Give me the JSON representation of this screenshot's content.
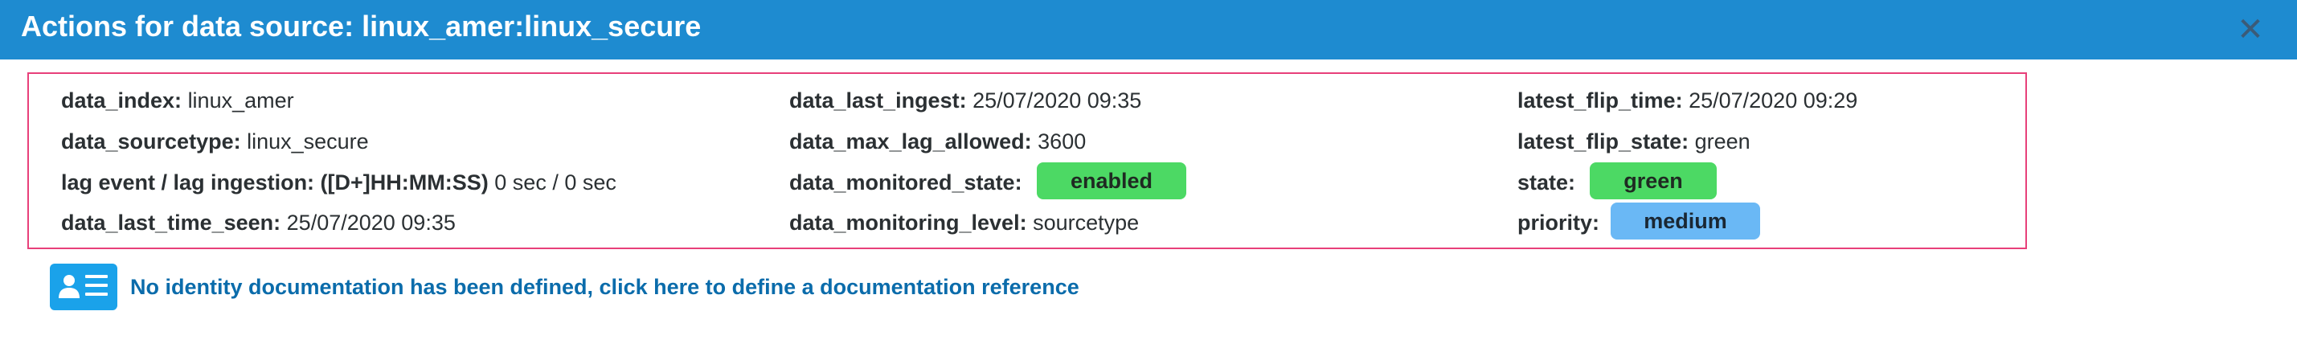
{
  "dialog": {
    "title": "Actions for data source: linux_amer:linux_secure",
    "close_glyph": "✕"
  },
  "info": {
    "col1": [
      {
        "key": "data_index:",
        "value": "linux_amer"
      },
      {
        "key": "data_sourcetype:",
        "value": "linux_secure"
      },
      {
        "key": "lag event / lag ingestion: ([D+]HH:MM:SS)",
        "value": "0 sec / 0 sec"
      },
      {
        "key": "data_last_time_seen:",
        "value": "25/07/2020 09:35"
      }
    ],
    "col2": [
      {
        "key": "data_last_ingest:",
        "value": "25/07/2020 09:35"
      },
      {
        "key": "data_max_lag_allowed:",
        "value": "3600"
      },
      {
        "key": "data_monitored_state:",
        "badge": "enabled"
      },
      {
        "key": "data_monitoring_level:",
        "value": "sourcetype"
      }
    ],
    "col3": [
      {
        "key": "latest_flip_time:",
        "value": "25/07/2020 09:29"
      },
      {
        "key": "latest_flip_state:",
        "value": "green"
      },
      {
        "key": "state:",
        "badge": "green"
      },
      {
        "key": "priority:",
        "badge": "medium"
      }
    ]
  },
  "badge_colors": {
    "enabled": "#4cd964",
    "green": "#4cd964",
    "medium": "#6ab8f5"
  },
  "documentation": {
    "icon": "id-card-icon",
    "link_text": "No identity documentation has been defined, click here to define a documentation reference"
  },
  "colors": {
    "header_bg": "#1e8bd0",
    "box_border": "#e8407a",
    "link": "#0b6cab"
  }
}
